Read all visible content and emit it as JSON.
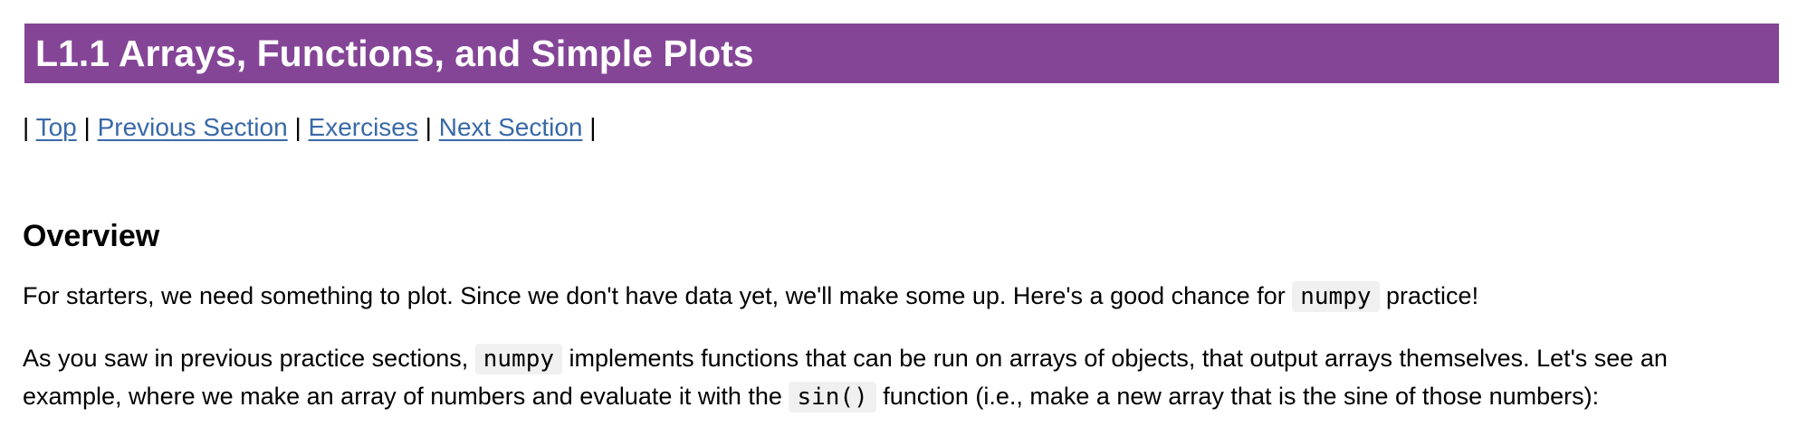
{
  "colors": {
    "banner_bg": "#844597",
    "banner_text": "#ffffff",
    "link": "#3969a8",
    "code_bg": "#f0f0f0"
  },
  "title": "L1.1 Arrays, Functions, and Simple Plots",
  "nav": {
    "sep": "|",
    "links": [
      {
        "label": "Top"
      },
      {
        "label": "Previous Section"
      },
      {
        "label": "Exercises"
      },
      {
        "label": "Next Section"
      }
    ]
  },
  "overview": {
    "heading": "Overview",
    "para1": {
      "before": "For starters, we need something to plot. Since we don't have data yet, we'll make some up. Here's a good chance for",
      "code": "numpy",
      "after": "practice!"
    },
    "para2": {
      "before": "As you saw in previous practice sections,",
      "code": "numpy",
      "after": "implements functions that can be run on arrays of objects, that output arrays themselves. Let's see an"
    },
    "para3": {
      "before": "example, where we make an array of numbers and evaluate it with the",
      "code": "sin()",
      "after": "function (i.e., make a new array that is the sine of those numbers):"
    }
  }
}
